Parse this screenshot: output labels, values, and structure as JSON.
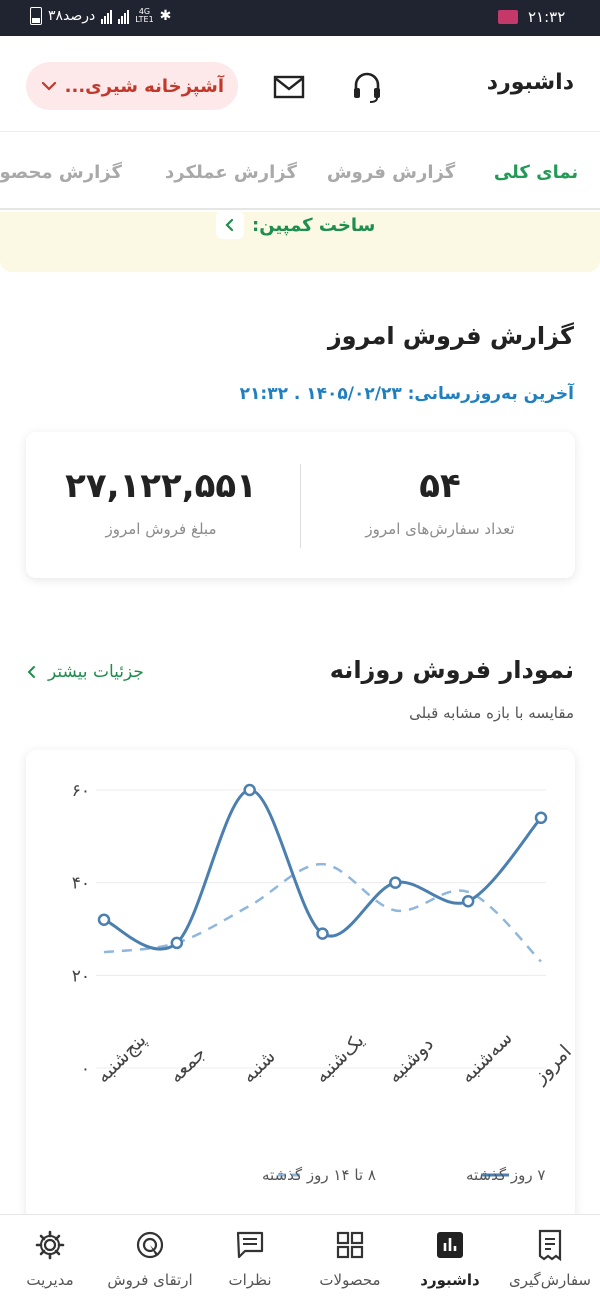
{
  "status_bar": {
    "time": "۲۱:۳۲",
    "battery_text": "۳۸درصد",
    "network": "4G",
    "network2": "LTE1"
  },
  "header": {
    "title": "داشبورد",
    "store_name": "آشپزخانه شیری..."
  },
  "tabs": [
    {
      "label": "نمای کلی",
      "active": true
    },
    {
      "label": "گزارش فروش",
      "active": false
    },
    {
      "label": "گزارش عملکرد",
      "active": false
    },
    {
      "label": "گزارش محصولات",
      "active": false
    }
  ],
  "banner": {
    "link_label": "ساخت کمپین:"
  },
  "today_report": {
    "title": "گزارش فروش امروز",
    "last_update": "آخرین به‌روزرسانی: ۱۴۰۵/۰۲/۲۳ . ۲۱:۳۲",
    "orders_value": "۵۴",
    "orders_label": "تعداد سفارش‌های امروز",
    "amount_value": "۲۷,۱۲۲,۵۵۱",
    "amount_label": "مبلغ فروش امروز"
  },
  "daily_chart": {
    "title": "نمودار فروش روزانه",
    "subtitle": "مقایسه با بازه مشابه قبلی",
    "more_label": "جزئیات بیشتر"
  },
  "chart_data": {
    "type": "line",
    "categories": [
      "پنج‌شنبه",
      "جمعه",
      "شنبه",
      "یک‌شنبه",
      "دوشنبه",
      "سه‌شنبه",
      "امروز"
    ],
    "y_tick_labels": [
      "۰",
      "۲۰",
      "۴۰",
      "۶۰"
    ],
    "y_ticks": [
      0,
      20,
      40,
      60
    ],
    "ylim": [
      0,
      60
    ],
    "grid": true,
    "legend_position": "bottom",
    "series": [
      {
        "name": "۷ روز گذشته",
        "values": [
          32,
          27,
          60,
          29,
          40,
          36,
          54
        ],
        "color": "#4a7fb0",
        "style": "solid"
      },
      {
        "name": "۸ تا ۱۴ روز گذشته",
        "values": [
          25,
          27,
          35,
          44,
          34,
          38,
          23
        ],
        "color": "#8fb7de",
        "style": "dashed"
      }
    ]
  },
  "bottom_nav": [
    {
      "label": "سفارش‌گیری",
      "icon": "receipt-icon",
      "active": false
    },
    {
      "label": "داشبورد",
      "icon": "chart-icon",
      "active": true
    },
    {
      "label": "محصولات",
      "icon": "grid-icon",
      "active": false
    },
    {
      "label": "نظرات",
      "icon": "comment-icon",
      "active": false
    },
    {
      "label": "ارتقای فروش",
      "icon": "target-icon",
      "active": false
    },
    {
      "label": "مدیریت",
      "icon": "gear-icon",
      "active": false
    }
  ]
}
